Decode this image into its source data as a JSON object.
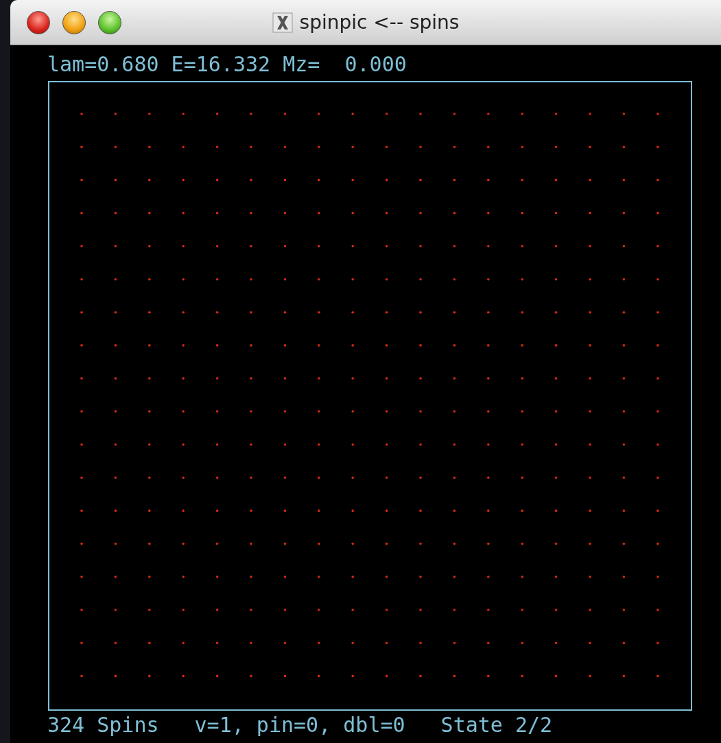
{
  "window": {
    "title": "spinpic <-- spins"
  },
  "header": "lam=0.680 E=16.332 Mz=  0.000",
  "status_bar": [
    "324 Spins",
    "v=1, pin=0, dbl=0",
    "State 2/2"
  ]
}
